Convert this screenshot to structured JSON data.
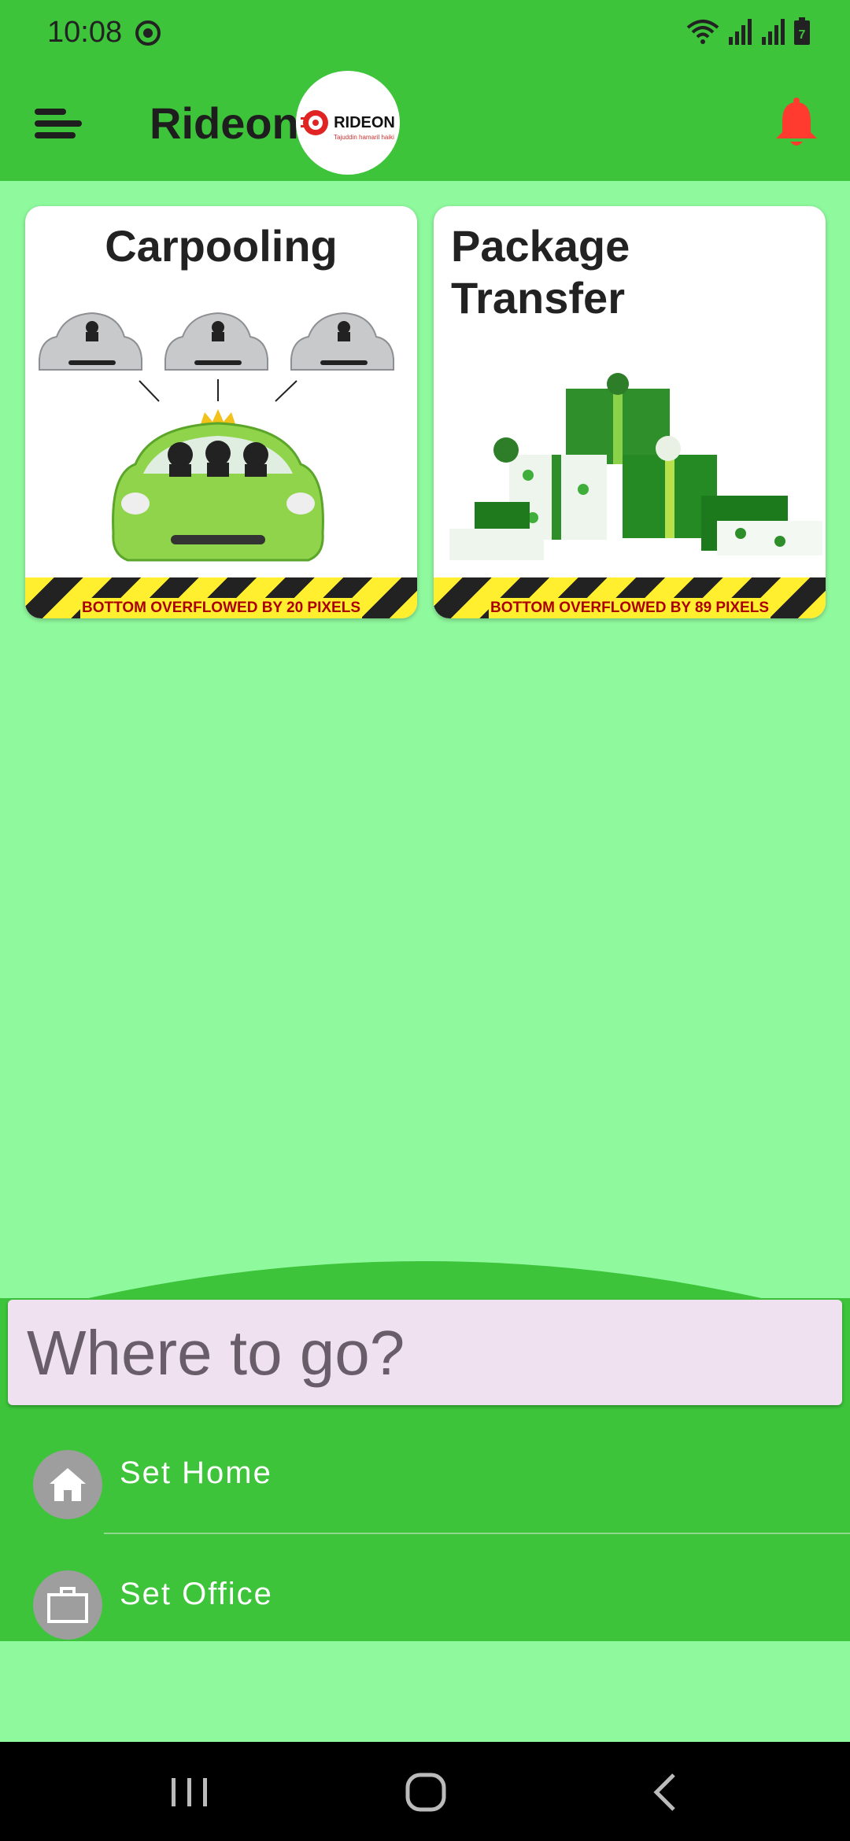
{
  "status_bar": {
    "time": "10:08",
    "battery": "7"
  },
  "app_bar": {
    "title": "Rideon",
    "logo_text": "RIDEON",
    "logo_tagline": "Tajuddin hamaril haiki"
  },
  "cards": [
    {
      "title": "Carpooling",
      "overflow_message": "BOTTOM OVERFLOWED BY 20 PIXELS"
    },
    {
      "title": "Package\nTransfer",
      "title_line1": "Package",
      "title_line2": "Transfer",
      "overflow_message": "BOTTOM OVERFLOWED BY 89 PIXELS"
    }
  ],
  "search": {
    "placeholder": "Where to go?"
  },
  "places": [
    {
      "label": "Set Home",
      "icon": "home-icon"
    },
    {
      "label": "Set Office",
      "icon": "briefcase-icon"
    }
  ],
  "colors": {
    "app_green": "#3dc43a",
    "background_green": "#8ff99d",
    "search_bg": "#efe1ef",
    "bell_red": "#ff3b2f"
  }
}
